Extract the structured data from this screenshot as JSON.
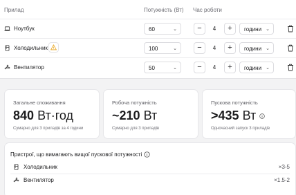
{
  "table": {
    "headers": {
      "device": "Прилад",
      "power": "Потужність (Вт)",
      "hours": "Час роботи"
    },
    "rows": [
      {
        "name": "Ноутбук",
        "icon": "laptop-icon",
        "power": "60",
        "qty": "4",
        "unit": "години",
        "warning": false
      },
      {
        "name": "Холодильник",
        "icon": "fridge-icon",
        "power": "100",
        "qty": "4",
        "unit": "години",
        "warning": true
      },
      {
        "name": "Вентилятор",
        "icon": "fan-icon",
        "power": "50",
        "qty": "4",
        "unit": "години",
        "warning": false
      }
    ],
    "minus": "−",
    "plus": "+"
  },
  "stats": [
    {
      "label": "Загальне споживання",
      "value": "840",
      "unit": "Вт·год",
      "sub": "Сумарно для 3 приладів за 4 години"
    },
    {
      "label": "Робоча потужність",
      "value": "~210",
      "unit": "Вт",
      "sub": "Сумарно для 3 приладів"
    },
    {
      "label": "Пускова потужність",
      "value": ">435",
      "unit": "Вт",
      "sub": "Одночасний запуск 3 приладів"
    }
  ],
  "peak": {
    "title": "Пристрої, що вимагають вищої пускової потужності",
    "items": [
      {
        "name": "Холодильник",
        "icon": "fridge-icon",
        "mult": "×3-5"
      },
      {
        "name": "Вентилятор",
        "icon": "fan-icon",
        "mult": "×1.5-2"
      }
    ]
  },
  "colors": {
    "warning": "#e8a317",
    "border": "#e4e4e7"
  }
}
